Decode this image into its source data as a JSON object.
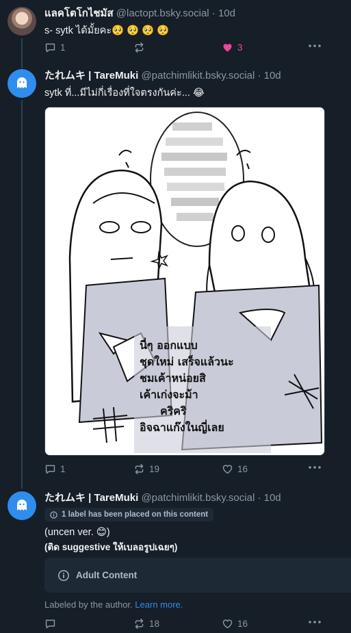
{
  "posts": [
    {
      "display_name": "แลคโตโกไชมัส",
      "handle": "@lactopt.bsky.social",
      "time": "· 10d",
      "text": "s- sytk ได้มั้ยคะ🥺 🥺 🥺 🥺",
      "replies": "1",
      "reposts": "",
      "likes": "3"
    },
    {
      "display_name": "たれムキ | TareMuki",
      "handle": "@patchimlikit.bsky.social",
      "time": "· 10d",
      "text": "sytk ที่...มีไม่กี่เรื่องที่ใจตรงกันค่ะ... 😂",
      "replies": "1",
      "reposts": "19",
      "likes": "16"
    },
    {
      "display_name": "たれムキ | TareMuki",
      "handle": "@patchimlikit.bsky.social",
      "time": "· 10d",
      "label_chip": "1 label has been placed on this content",
      "text_line1": "(uncen ver. 😊)",
      "text_line2": "(ติด suggestive ให้เบลอรูปเฉยๆ)",
      "warning_label": "Adult Content",
      "labeled_by": "Labeled by the author.",
      "learn_more": "Learn more.",
      "replies": "",
      "reposts": "18",
      "likes": "16"
    }
  ],
  "image_text": [
    "นี่ๆ ออกแบบ",
    "ชุดใหม่ เสร็จแล้วนะ",
    "ชมเค้าหน่อยสิ",
    "เค้าเก่งจะม้า",
    "คริคริ",
    "อิจฉาแก๊งในญี่เลย"
  ],
  "colors": {
    "background": "#161e27",
    "text_secondary": "#8b98a5",
    "like_active": "#ec4899",
    "link": "#2f8ded"
  }
}
